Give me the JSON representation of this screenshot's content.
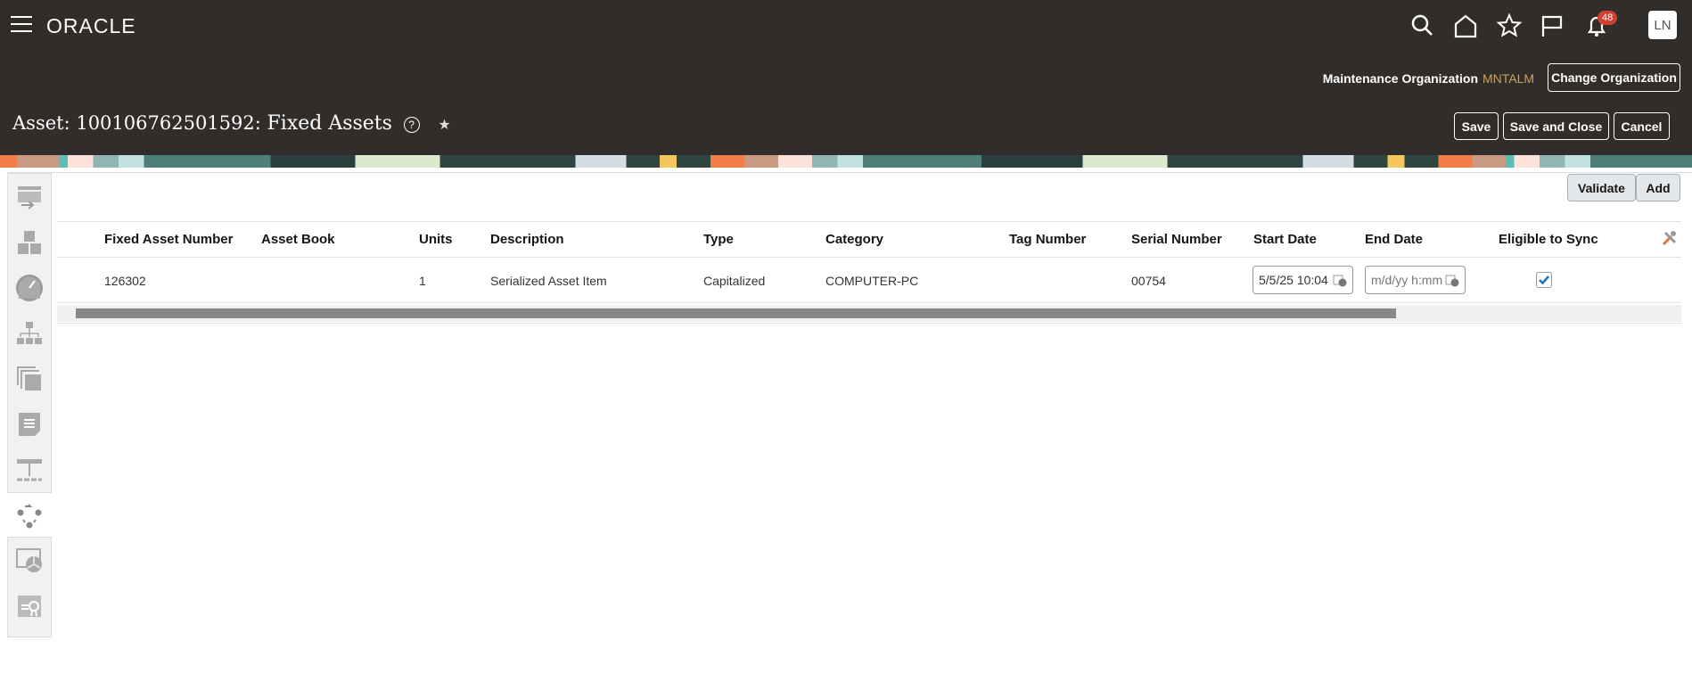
{
  "header": {
    "logo": "ORACLE",
    "notification_count": "48",
    "avatar_initials": "LN",
    "org_label": "Maintenance Organization",
    "org_value": "MNTALM",
    "change_org_label": "Change Organization",
    "title_prefix": "Asset: 100106762501592:",
    "title_main": "Fixed Assets",
    "help": "?"
  },
  "actions": {
    "save": "Save",
    "save_close": "Save and Close",
    "cancel": "Cancel",
    "validate": "Validate",
    "add": "Add"
  },
  "table": {
    "columns": [
      "Fixed Asset Number",
      "Asset Book",
      "Units",
      "Description",
      "Type",
      "Category",
      "Tag Number",
      "Serial Number",
      "Start Date",
      "End Date",
      "Eligible to Sync"
    ],
    "rows": [
      {
        "fixed_asset_number": "126302",
        "asset_book": "",
        "units": "1",
        "description": "Serialized Asset Item",
        "type": "Capitalized",
        "category": "COMPUTER-PC",
        "tag_number": "",
        "serial_number": "00754",
        "start_date": "5/5/25 10:04",
        "end_date_placeholder": "m/d/yy h:mm",
        "eligible_to_sync": true
      }
    ]
  },
  "colors": {
    "header_bg": "#312d2a",
    "org_value": "#c9a45c",
    "badge": "#d0402f",
    "check": "#1a73c8"
  }
}
